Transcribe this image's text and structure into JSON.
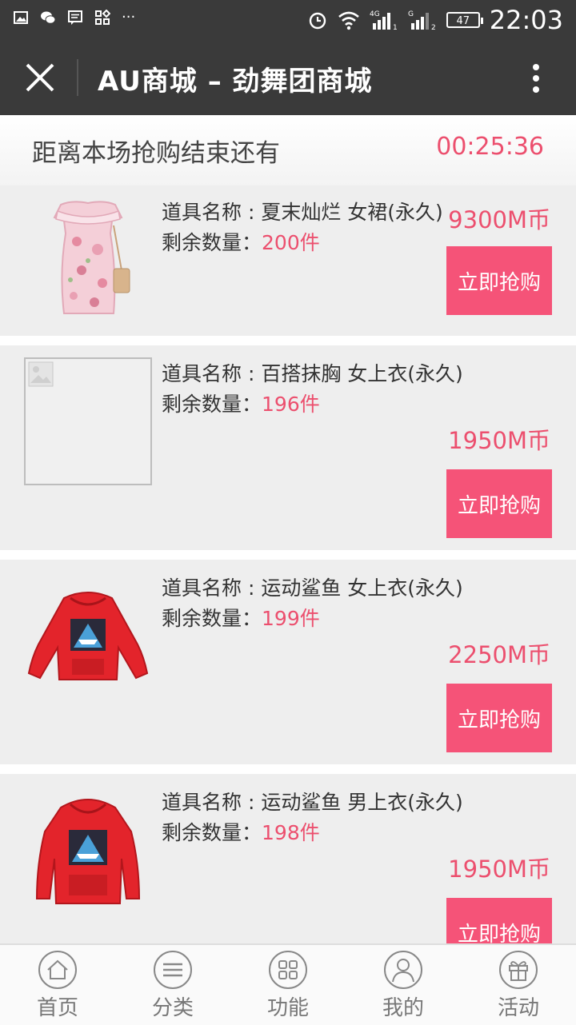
{
  "status_bar": {
    "time": "22:03",
    "battery": "47",
    "network": "4G"
  },
  "header": {
    "title": "AU商城 – 劲舞团商城"
  },
  "countdown": {
    "label": "距离本场抢购结束还有",
    "time": "00:25:36"
  },
  "items": [
    {
      "name": "道具名称 : 夏末灿烂 女裙(永久)",
      "stock_label": "剩余数量：",
      "stock": "200件",
      "price": "9300M币",
      "buy_label": "立即抢购",
      "image": "pink-floral-dress"
    },
    {
      "name": "道具名称 : 百搭抹胸 女上衣(永久)",
      "stock_label": "剩余数量：",
      "stock": "196件",
      "price": "1950M币",
      "buy_label": "立即抢购",
      "image": "image-placeholder"
    },
    {
      "name": "道具名称 : 运动鲨鱼 女上衣(永久)",
      "stock_label": "剩余数量：",
      "stock": "199件",
      "price": "2250M币",
      "buy_label": "立即抢购",
      "image": "red-shark-hoodie"
    },
    {
      "name": "道具名称 : 运动鲨鱼 男上衣(永久)",
      "stock_label": "剩余数量：",
      "stock": "198件",
      "price": "1950M币",
      "buy_label": "立即抢购",
      "image": "red-shark-hoodie"
    }
  ],
  "bottom_nav": [
    {
      "label": "首页",
      "icon": "home-icon"
    },
    {
      "label": "分类",
      "icon": "menu-icon"
    },
    {
      "label": "功能",
      "icon": "grid-icon"
    },
    {
      "label": "我的",
      "icon": "user-icon"
    },
    {
      "label": "活动",
      "icon": "gift-icon"
    }
  ],
  "colors": {
    "accent": "#ec4f6e",
    "button": "#f55378",
    "header": "#3a3a3a"
  }
}
